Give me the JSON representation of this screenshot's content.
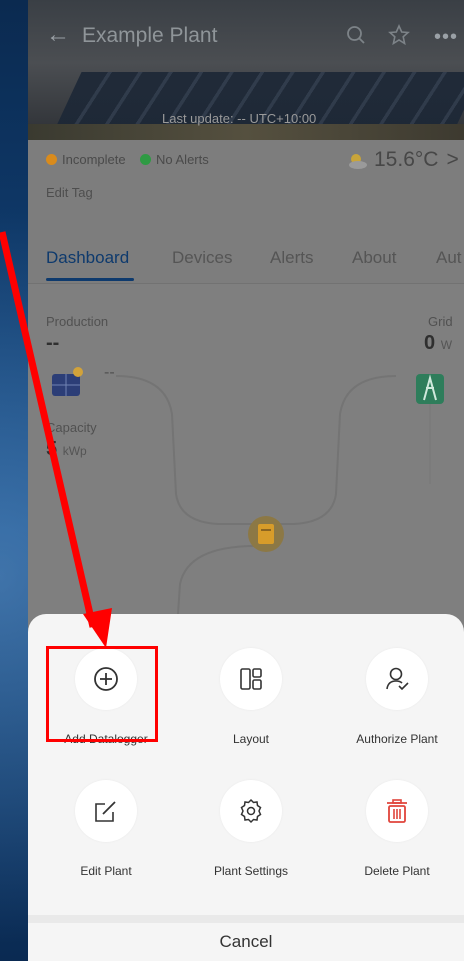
{
  "header": {
    "title": "Example Plant",
    "last_update": "Last update: -- UTC+10:00"
  },
  "status": {
    "state": "Incomplete",
    "state_color": "#d98b1c",
    "alerts": "No Alerts",
    "alerts_color": "#2e9a43",
    "edit_tag": "Edit Tag",
    "temperature": "15.6°C",
    "chevron": ">"
  },
  "tabs": [
    {
      "label": "Dashboard",
      "active": true
    },
    {
      "label": "Devices"
    },
    {
      "label": "Alerts"
    },
    {
      "label": "About"
    },
    {
      "label": "Aut"
    }
  ],
  "dashboard": {
    "production_label": "Production",
    "production_value": "--",
    "pv_value": "--",
    "capacity_label": "Capacity",
    "capacity_value": "5",
    "capacity_unit": "kWp",
    "grid_label": "Grid",
    "grid_value": "0",
    "grid_unit": "W"
  },
  "sheet": {
    "actions": [
      {
        "label": "Add Datalogger",
        "icon": "plus-circle-icon",
        "highlighted": true
      },
      {
        "label": "Layout",
        "icon": "layout-icon"
      },
      {
        "label": "Authorize Plant",
        "icon": "user-check-icon"
      },
      {
        "label": "Edit Plant",
        "icon": "edit-icon"
      },
      {
        "label": "Plant Settings",
        "icon": "gear-icon"
      },
      {
        "label": "Delete Plant",
        "icon": "trash-icon",
        "color": "#e0443b"
      }
    ],
    "cancel": "Cancel"
  },
  "annotation": {
    "color": "#ff0000"
  }
}
